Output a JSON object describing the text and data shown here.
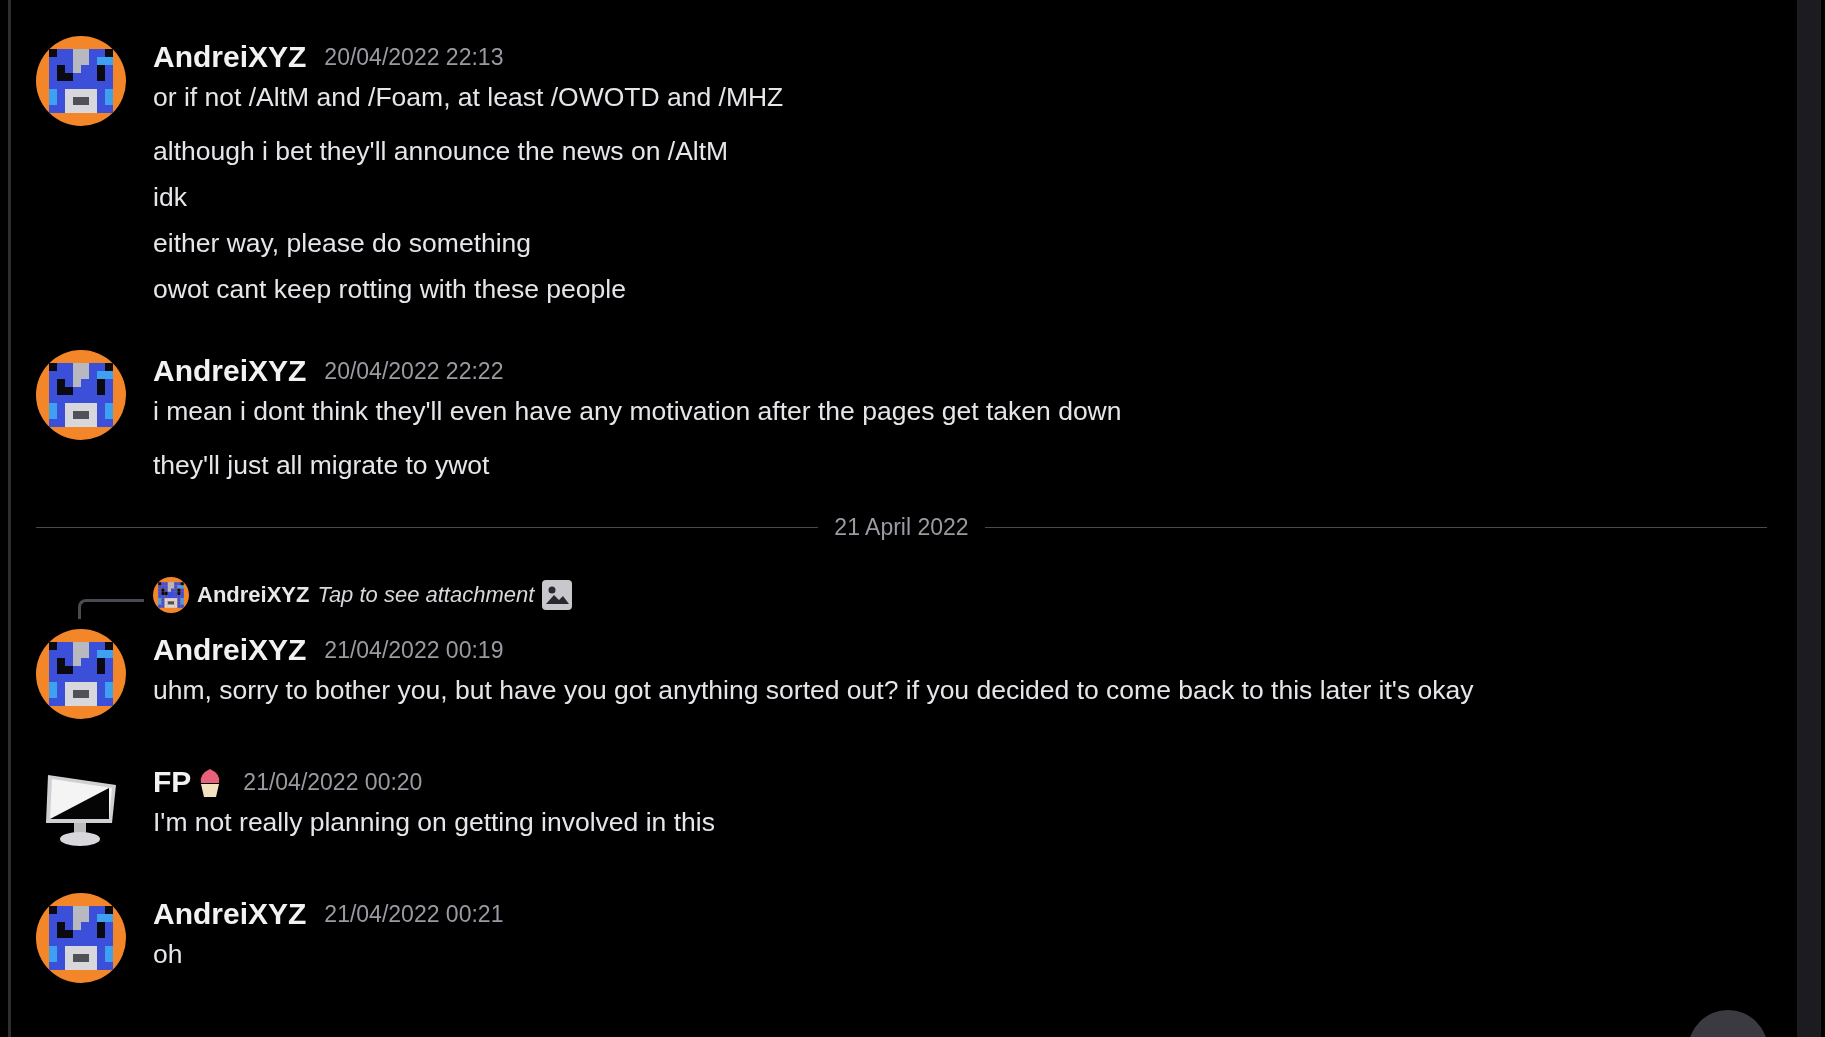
{
  "feed": [
    {
      "kind": "message",
      "avatar": {
        "kind": "cow"
      },
      "author": "AndreiXYZ",
      "timestamp": "20/04/2022 22:13",
      "lines": [
        "or if not /AltM and /Foam, at least /OWOTD and /MHZ",
        "although i bet they'll announce the news on /AltM",
        "idk",
        "either way, please do something",
        "owot cant keep rotting with these people"
      ]
    },
    {
      "kind": "message",
      "avatar": {
        "kind": "cow"
      },
      "author": "AndreiXYZ",
      "timestamp": "20/04/2022 22:22",
      "lines": [
        "i mean i dont think they'll even have any motivation after the pages get taken down",
        "they'll just all migrate to ywot"
      ]
    },
    {
      "kind": "divider",
      "label": "21 April 2022"
    },
    {
      "kind": "message",
      "avatar": {
        "kind": "cow"
      },
      "author": "AndreiXYZ",
      "timestamp": "21/04/2022 00:19",
      "reply": {
        "author": "AndreiXYZ",
        "text": "Tap to see attachment"
      },
      "lines": [
        "uhm, sorry to bother you, but have you got anything sorted out? if you decided to come back to this later it's okay"
      ]
    },
    {
      "kind": "message",
      "avatar": {
        "kind": "monitor"
      },
      "author": "FP",
      "cupcake_badge": true,
      "timestamp": "21/04/2022 00:20",
      "lines": [
        "I'm not really planning on getting involved in this"
      ]
    },
    {
      "kind": "message",
      "avatar": {
        "kind": "cow"
      },
      "author": "AndreiXYZ",
      "timestamp": "21/04/2022 00:21",
      "lines": [
        "oh"
      ]
    }
  ]
}
